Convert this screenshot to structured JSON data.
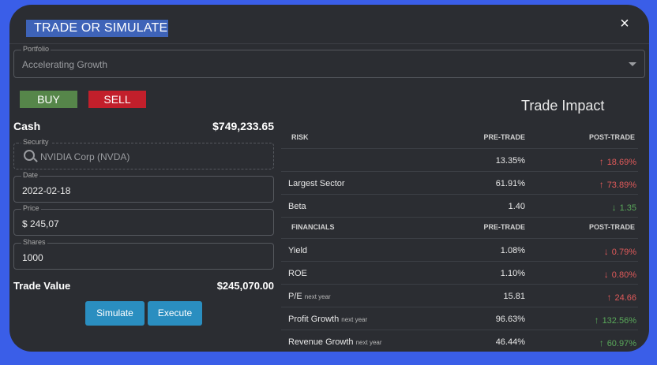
{
  "title": "TRADE OR SIMULATE",
  "close_icon": "×",
  "portfolio": {
    "label": "Portfolio",
    "value": "Accelerating Growth"
  },
  "buy_label": "BUY",
  "sell_label": "SELL",
  "cash": {
    "label": "Cash",
    "value": "$749,233.65"
  },
  "security": {
    "label": "Security",
    "value": "NVIDIA Corp (NVDA)"
  },
  "date": {
    "label": "Date",
    "value": "2022-02-18"
  },
  "price": {
    "label": "Price",
    "value": "$ 245,07"
  },
  "shares": {
    "label": "Shares",
    "value": "1000"
  },
  "trade_value": {
    "label": "Trade Value",
    "value": "$245,070.00"
  },
  "simulate_label": "Simulate",
  "execute_label": "Execute",
  "impact_title": "Trade Impact",
  "risk": {
    "headers": [
      "RISK",
      "PRE-TRADE",
      "POST-TRADE"
    ],
    "rows": [
      {
        "label": "",
        "sub": "",
        "pre": "13.35%",
        "post": "18.69%",
        "arrow": "↑"
      },
      {
        "label": "Largest Sector",
        "sub": "",
        "pre": "61.91%",
        "post": "73.89%",
        "arrow": "↑"
      },
      {
        "label": "Beta",
        "sub": "",
        "pre": "1.40",
        "post": "1.35",
        "arrow": "↓"
      }
    ]
  },
  "financials": {
    "headers": [
      "FINANCIALS",
      "PRE-TRADE",
      "POST-TRADE"
    ],
    "rows": [
      {
        "label": "Yield",
        "sub": "",
        "pre": "1.08%",
        "post": "0.79%",
        "arrow": "↓"
      },
      {
        "label": "ROE",
        "sub": "",
        "pre": "1.10%",
        "post": "0.80%",
        "arrow": "↓"
      },
      {
        "label": "P/E",
        "sub": "next year",
        "pre": "15.81",
        "post": "24.66",
        "arrow": "↑"
      },
      {
        "label": "Profit Growth",
        "sub": "next year",
        "pre": "96.63%",
        "post": "132.56%",
        "arrow": "↑"
      },
      {
        "label": "Revenue Growth",
        "sub": "next year",
        "pre": "46.44%",
        "post": "60.97%",
        "arrow": "↑"
      }
    ]
  },
  "colors": {
    "up_bad": "#e05a5a",
    "good": "#5aa85a",
    "buy": "#56864a",
    "sell": "#c21f2b",
    "accent": "#2a8ec0",
    "background": "#3a5ee8"
  }
}
